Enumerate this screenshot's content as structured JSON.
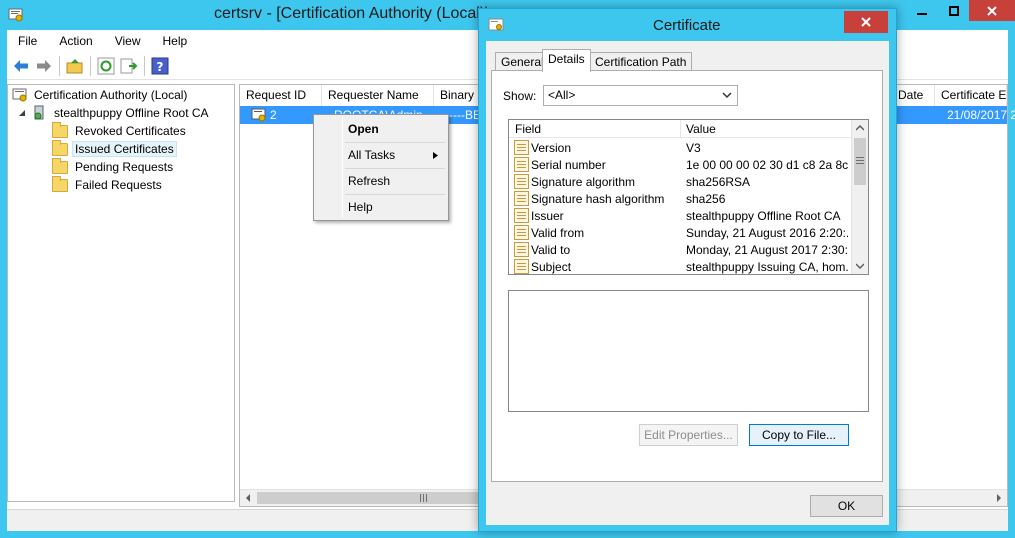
{
  "main_window": {
    "title": "certsrv - [Certification Authority (Local)\\",
    "menu": [
      "File",
      "Action",
      "View",
      "Help"
    ],
    "tree": {
      "root": "Certification Authority (Local)",
      "ca": "stealthpuppy Offline Root CA",
      "folders": [
        "Revoked Certificates",
        "Issued Certificates",
        "Pending Requests",
        "Failed Requests"
      ],
      "selected": "Issued Certificates"
    },
    "list": {
      "columns": [
        "Request ID",
        "Requester Name",
        "Binary C",
        "Date",
        "Certificate Ex"
      ],
      "row": {
        "request_id": "2",
        "requester": "ROOTCA\\Admin",
        "binary": "-----BE",
        "expiry": "21/08/2017 2"
      }
    }
  },
  "context_menu": {
    "items": [
      {
        "label": "Open",
        "bold": true
      },
      {
        "label": "All Tasks",
        "submenu": true
      },
      {
        "label": "Refresh"
      },
      {
        "label": "Help"
      }
    ]
  },
  "certificate_dialog": {
    "title": "Certificate",
    "tabs": [
      "General",
      "Details",
      "Certification Path"
    ],
    "active_tab": "Details",
    "show_label": "Show:",
    "show_value": "<All>",
    "grid_headers": {
      "field": "Field",
      "value": "Value"
    },
    "rows": [
      {
        "field": "Version",
        "value": "V3"
      },
      {
        "field": "Serial number",
        "value": "1e 00 00 00 02 30 d1 c8 2a 8c..."
      },
      {
        "field": "Signature algorithm",
        "value": "sha256RSA"
      },
      {
        "field": "Signature hash algorithm",
        "value": "sha256"
      },
      {
        "field": "Issuer",
        "value": "stealthpuppy Offline Root CA"
      },
      {
        "field": "Valid from",
        "value": "Sunday, 21 August 2016 2:20:..."
      },
      {
        "field": "Valid to",
        "value": "Monday, 21 August 2017 2:30:..."
      },
      {
        "field": "Subject",
        "value": "stealthpuppy Issuing CA, hom..."
      }
    ],
    "buttons": {
      "edit_properties": "Edit Properties...",
      "copy_to_file": "Copy to File...",
      "ok": "OK"
    }
  }
}
